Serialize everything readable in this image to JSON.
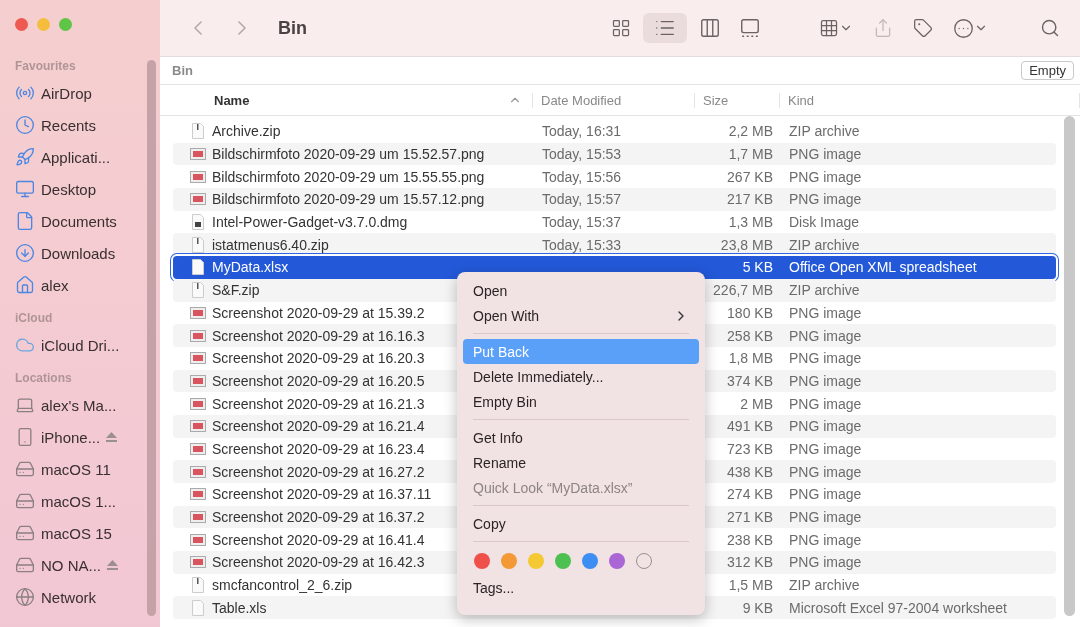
{
  "window": {
    "title": "Bin"
  },
  "sidebar": {
    "sections": [
      {
        "title": "Favourites",
        "items": [
          {
            "label": "AirDrop",
            "eject": false
          },
          {
            "label": "Recents",
            "eject": false
          },
          {
            "label": "Applicati...",
            "eject": false
          },
          {
            "label": "Desktop",
            "eject": false
          },
          {
            "label": "Documents",
            "eject": false
          },
          {
            "label": "Downloads",
            "eject": false
          },
          {
            "label": "alex",
            "eject": false
          }
        ]
      },
      {
        "title": "iCloud",
        "items": [
          {
            "label": "iCloud Dri...",
            "eject": false
          }
        ]
      },
      {
        "title": "Locations",
        "items": [
          {
            "label": "alex's Ma...",
            "eject": false
          },
          {
            "label": "iPhone...",
            "eject": true
          },
          {
            "label": "macOS 11",
            "eject": false
          },
          {
            "label": "macOS 1...",
            "eject": false
          },
          {
            "label": "macOS 15",
            "eject": false
          },
          {
            "label": "NO NA...",
            "eject": true
          },
          {
            "label": "Network",
            "eject": false
          }
        ]
      }
    ]
  },
  "path_bar": {
    "label": "Bin",
    "button": "Empty"
  },
  "table": {
    "columns": [
      "Name",
      "Date Modified",
      "Size",
      "Kind"
    ],
    "rows": [
      {
        "name": "Archive.zip",
        "date": "Today, 16:31",
        "size": "2,2 MB",
        "file_kind": "ZIP archive",
        "kind": "zip",
        "selected": false
      },
      {
        "name": "Bildschirmfoto 2020-09-29 um 15.52.57.png",
        "date": "Today, 15:53",
        "size": "1,7 MB",
        "file_kind": "PNG image",
        "kind": "png",
        "selected": false
      },
      {
        "name": "Bildschirmfoto 2020-09-29 um 15.55.55.png",
        "date": "Today, 15:56",
        "size": "267 KB",
        "file_kind": "PNG image",
        "kind": "png",
        "selected": false
      },
      {
        "name": "Bildschirmfoto 2020-09-29 um 15.57.12.png",
        "date": "Today, 15:57",
        "size": "217 KB",
        "file_kind": "PNG image",
        "kind": "png",
        "selected": false
      },
      {
        "name": "Intel-Power-Gadget-v3.7.0.dmg",
        "date": "Today, 15:37",
        "size": "1,3 MB",
        "file_kind": "Disk Image",
        "kind": "dmg",
        "selected": false
      },
      {
        "name": "istatmenus6.40.zip",
        "date": "Today, 15:33",
        "size": "23,8 MB",
        "file_kind": "ZIP archive",
        "kind": "zip",
        "selected": false
      },
      {
        "name": "MyData.xlsx",
        "size": "5 KB",
        "file_kind": "Office Open XML spreadsheet",
        "kind": "doc",
        "selected": true
      },
      {
        "name": "S&F.zip",
        "size": "226,7 MB",
        "file_kind": "ZIP archive",
        "kind": "zip",
        "selected": false
      },
      {
        "name": "Screenshot 2020-09-29 at 15.39.2",
        "size": "180 KB",
        "file_kind": "PNG image",
        "kind": "png",
        "selected": false
      },
      {
        "name": "Screenshot 2020-09-29 at 16.16.3",
        "size": "258 KB",
        "file_kind": "PNG image",
        "kind": "png",
        "selected": false
      },
      {
        "name": "Screenshot 2020-09-29 at 16.20.3",
        "size": "1,8 MB",
        "file_kind": "PNG image",
        "kind": "png",
        "selected": false
      },
      {
        "name": "Screenshot 2020-09-29 at 16.20.5",
        "size": "374 KB",
        "file_kind": "PNG image",
        "kind": "png",
        "selected": false
      },
      {
        "name": "Screenshot 2020-09-29 at 16.21.3",
        "size": "2 MB",
        "file_kind": "PNG image",
        "kind": "png",
        "selected": false
      },
      {
        "name": "Screenshot 2020-09-29 at 16.21.4",
        "size": "491 KB",
        "file_kind": "PNG image",
        "kind": "png",
        "selected": false
      },
      {
        "name": "Screenshot 2020-09-29 at 16.23.4",
        "size": "723 KB",
        "file_kind": "PNG image",
        "kind": "png",
        "selected": false
      },
      {
        "name": "Screenshot 2020-09-29 at 16.27.2",
        "size": "438 KB",
        "file_kind": "PNG image",
        "kind": "png",
        "selected": false
      },
      {
        "name": "Screenshot 2020-09-29 at 16.37.11",
        "size": "274 KB",
        "file_kind": "PNG image",
        "kind": "png",
        "selected": false
      },
      {
        "name": "Screenshot 2020-09-29 at 16.37.2",
        "size": "271 KB",
        "file_kind": "PNG image",
        "kind": "png",
        "selected": false
      },
      {
        "name": "Screenshot 2020-09-29 at 16.41.4",
        "size": "238 KB",
        "file_kind": "PNG image",
        "kind": "png",
        "selected": false
      },
      {
        "name": "Screenshot 2020-09-29 at 16.42.3",
        "size": "312 KB",
        "file_kind": "PNG image",
        "kind": "png",
        "selected": false
      },
      {
        "name": "smcfancontrol_2_6.zip",
        "size": "1,5 MB",
        "file_kind": "ZIP archive",
        "kind": "zip",
        "selected": false
      },
      {
        "name": "Table.xls",
        "size": "9 KB",
        "file_kind": "Microsoft Excel 97-2004 worksheet",
        "kind": "doc",
        "selected": false
      }
    ]
  },
  "context_menu": {
    "sections": [
      [
        {
          "label": "Open",
          "submenu": false,
          "selected": false,
          "disabled": false
        },
        {
          "label": "Open With",
          "submenu": true,
          "selected": false,
          "disabled": false
        }
      ],
      [
        {
          "label": "Put Back",
          "submenu": false,
          "selected": true,
          "disabled": false
        },
        {
          "label": "Delete Immediately...",
          "submenu": false,
          "selected": false,
          "disabled": false
        },
        {
          "label": "Empty Bin",
          "submenu": false,
          "selected": false,
          "disabled": false
        }
      ],
      [
        {
          "label": "Get Info",
          "submenu": false,
          "selected": false,
          "disabled": false
        },
        {
          "label": "Rename",
          "submenu": false,
          "selected": false,
          "disabled": false
        },
        {
          "label": "Quick Look “MyData.xlsx”",
          "submenu": false,
          "selected": false,
          "disabled": true
        }
      ],
      [
        {
          "label": "Copy",
          "submenu": false,
          "selected": false,
          "disabled": false
        }
      ]
    ],
    "tags": [
      {
        "kind": "dot",
        "color": "#f0504a"
      },
      {
        "kind": "dot",
        "color": "#f39a37"
      },
      {
        "kind": "dot",
        "color": "#f5c934"
      },
      {
        "kind": "dot",
        "color": "#4cc152"
      },
      {
        "kind": "dot",
        "color": "#3d8ef3"
      },
      {
        "kind": "dot",
        "color": "#a966d4"
      },
      {
        "kind": "none"
      }
    ],
    "tags_item": "Tags..."
  }
}
